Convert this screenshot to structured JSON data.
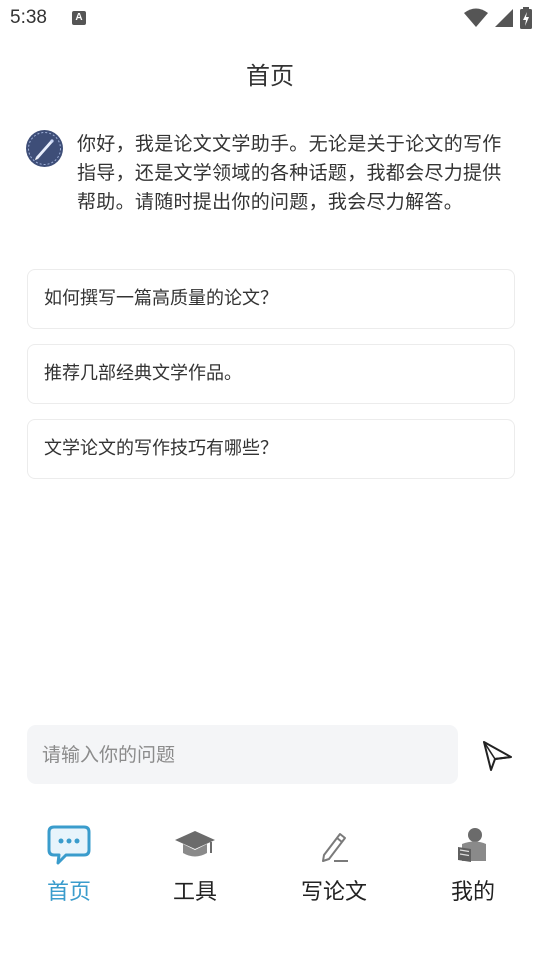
{
  "status_bar": {
    "time": "5:38",
    "notification_letter": "A"
  },
  "header": {
    "title": "首页"
  },
  "chat": {
    "welcome_message": "你好，我是论文文学助手。无论是关于论文的写作指导，还是文学领域的各种话题，我都会尽力提供帮助。请随时提出你的问题，我会尽力解答。"
  },
  "suggestions": [
    {
      "text": "如何撰写一篇高质量的论文？"
    },
    {
      "text": "推荐几部经典文学作品。"
    },
    {
      "text": "文学论文的写作技巧有哪些？"
    }
  ],
  "input": {
    "placeholder": "请输入你的问题",
    "value": ""
  },
  "tabs": [
    {
      "label": "首页",
      "icon": "chat-bubble-icon",
      "active": true
    },
    {
      "label": "工具",
      "icon": "graduation-cap-icon",
      "active": false
    },
    {
      "label": "写论文",
      "icon": "pencil-icon",
      "active": false
    },
    {
      "label": "我的",
      "icon": "user-reading-icon",
      "active": false
    }
  ],
  "colors": {
    "accent": "#3a9ccc",
    "avatar_bg": "#3e4e78",
    "input_bg": "#f4f5f7"
  }
}
